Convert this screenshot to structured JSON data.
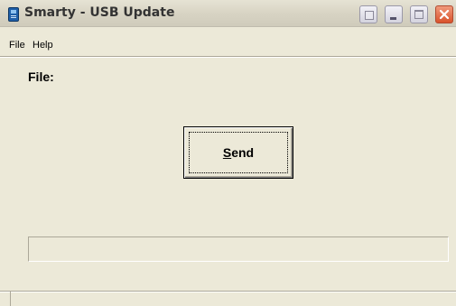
{
  "window": {
    "title": "Smarty - USB Update"
  },
  "menu": {
    "items": [
      {
        "label": "File"
      },
      {
        "label": "Help"
      }
    ]
  },
  "main": {
    "file_label": "File:",
    "send_button": {
      "label_mnemonic": "S",
      "label_rest": "end"
    }
  },
  "progress": {
    "value": 0
  },
  "colors": {
    "window_bg": "#ece9d8",
    "close_button": "#d9522b",
    "app_icon": "#1f5fa8"
  },
  "icons": {
    "app": "smarty-phone-icon",
    "help": "context-help-icon",
    "minimize": "minimize-icon",
    "maximize": "maximize-icon",
    "close": "close-icon"
  }
}
